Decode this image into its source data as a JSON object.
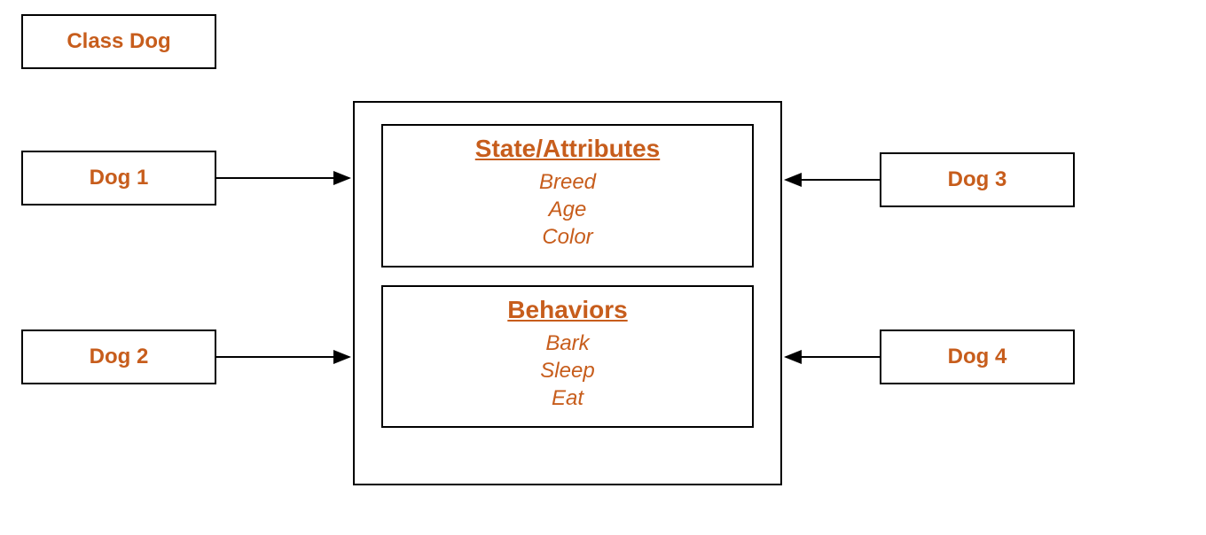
{
  "diagram": {
    "class_label": "Class Dog",
    "instances": {
      "left_top": "Dog 1",
      "left_bottom": "Dog 2",
      "right_top": "Dog 3",
      "right_bottom": "Dog 4"
    },
    "sections": {
      "attributes": {
        "title": "State/Attributes",
        "items": [
          "Breed",
          "Age",
          "Color"
        ]
      },
      "behaviors": {
        "title": "Behaviors",
        "items": [
          "Bark",
          "Sleep",
          "Eat"
        ]
      }
    }
  },
  "colors": {
    "text_accent": "#c75d1c",
    "border": "#000000"
  }
}
